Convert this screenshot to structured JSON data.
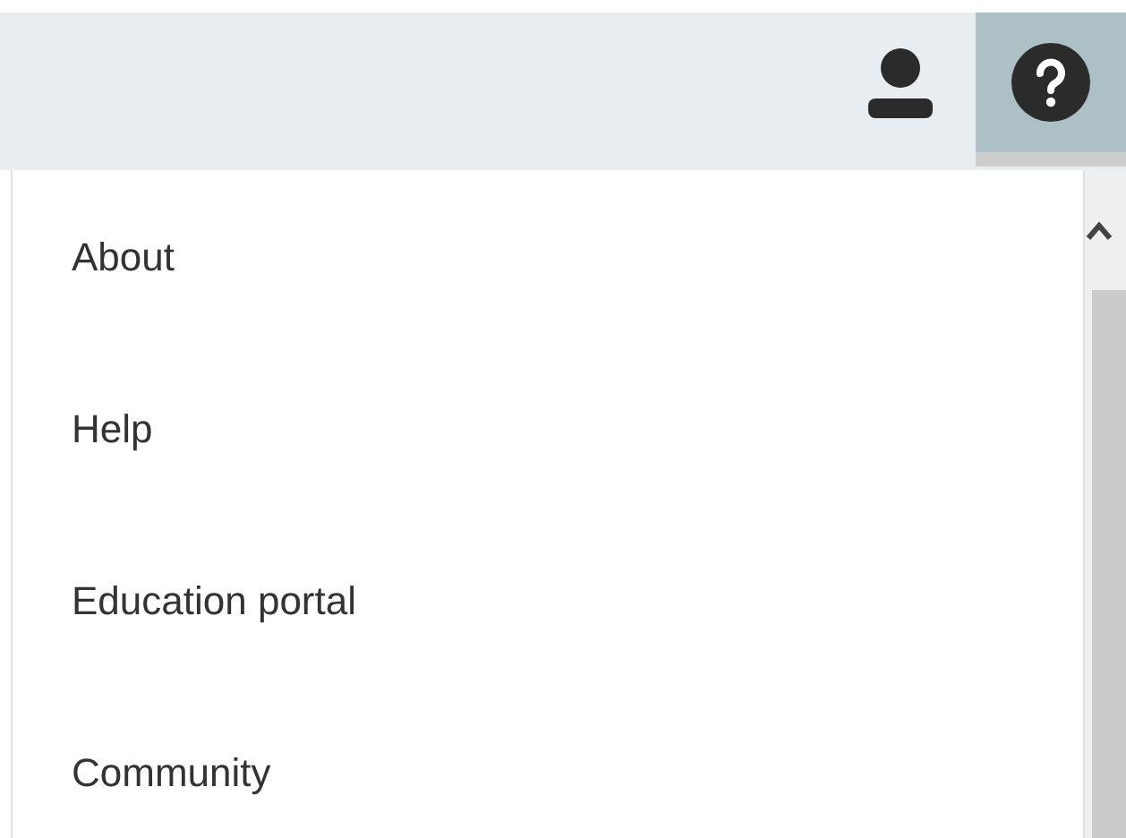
{
  "header": {
    "help_button": {
      "active": true
    }
  },
  "help_menu": {
    "items": [
      {
        "label": "About"
      },
      {
        "label": "Help"
      },
      {
        "label": "Education portal"
      },
      {
        "label": "Community"
      }
    ]
  }
}
